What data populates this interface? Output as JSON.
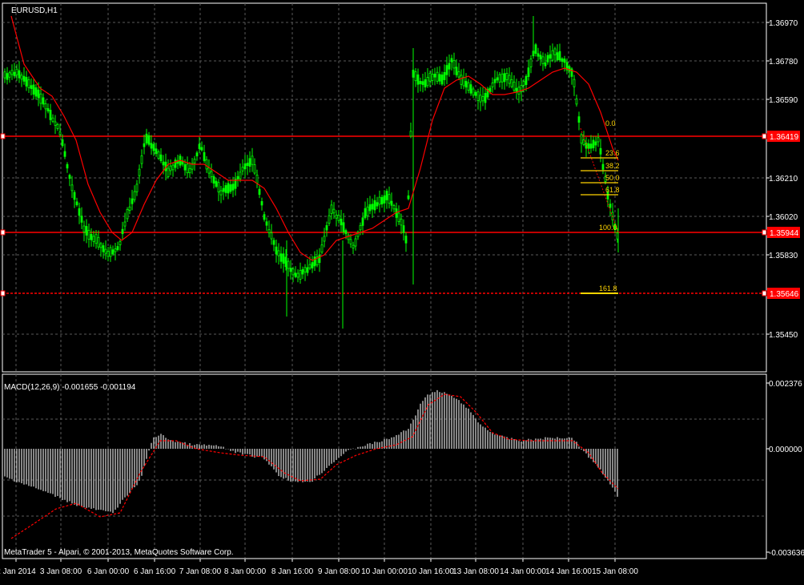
{
  "symbol_label": "EURUSD,H1",
  "macd_label": "MACD(12,26,9) -0.001655 -0.001194",
  "copyright": "MetaTrader 5 - Alpari, © 2001-2013, MetaQuotes Software Corp.",
  "price_axis": [
    "1.36970",
    "1.36780",
    "1.36590",
    "1.36210",
    "1.36020",
    "1.35830",
    "1.35450"
  ],
  "price_tags": [
    {
      "value": "1.36419",
      "dashed": false
    },
    {
      "value": "1.35944",
      "dashed": false
    },
    {
      "value": "1.35646",
      "dashed": true
    }
  ],
  "macd_axis": [
    "0.002376",
    "0.000000",
    "-0.003636"
  ],
  "time_axis": [
    "2 Jan 2014",
    "3 Jan 08:00",
    "6 Jan 00:00",
    "6 Jan 16:00",
    "7 Jan 08:00",
    "8 Jan 00:00",
    "8 Jan 16:00",
    "9 Jan 08:00",
    "10 Jan 00:00",
    "10 Jan 16:00",
    "13 Jan 08:00",
    "14 Jan 00:00",
    "14 Jan 16:00",
    "15 Jan 08:00"
  ],
  "fib_levels": [
    "0.0",
    "23.6",
    "38.2",
    "50.0",
    "61.8",
    "100.0",
    "161.8"
  ],
  "colors": {
    "background": "#000000",
    "candle": "#00ff00",
    "moving_average": "#ff0000",
    "level_line": "#ff0000",
    "fibonacci": "#ffd400",
    "histogram": "#c0c0c0",
    "signal": "#ff0000",
    "grid": "#5a5a5a"
  }
}
